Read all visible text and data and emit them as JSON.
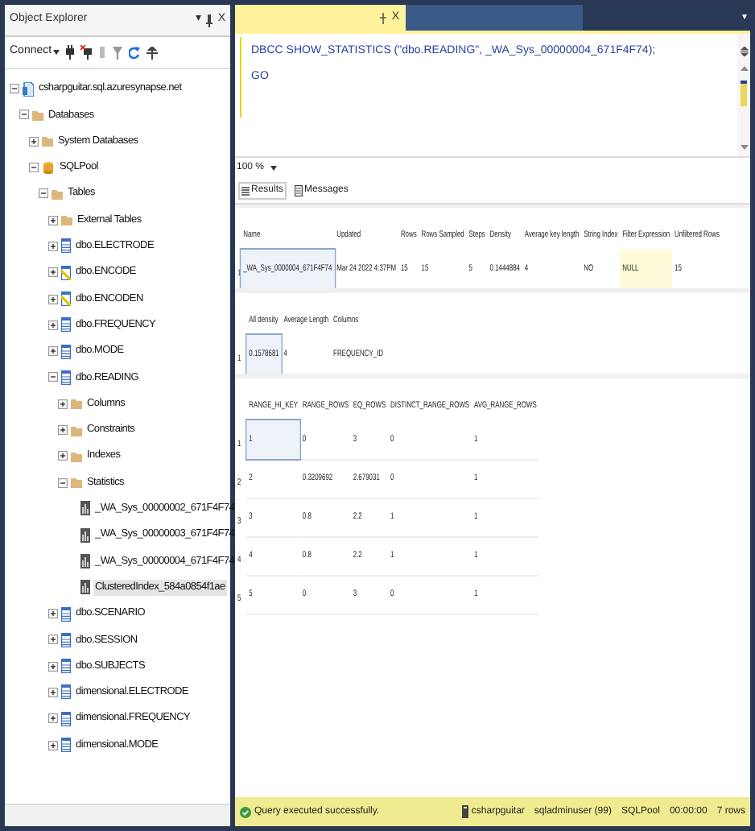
{
  "object_explorer": {
    "title": "Object Explorer",
    "title_buttons": [
      "▾",
      "X"
    ],
    "connect_label": "Connect",
    "tree": [
      {
        "label": "csharpguitar.sql.azuresynapse.net",
        "kind": "server",
        "expanded": true,
        "selected": false,
        "children": [
          {
            "label": "Databases",
            "kind": "folder",
            "expanded": true,
            "selected": false,
            "children": [
              {
                "label": "System Databases",
                "kind": "folder",
                "expanded": false,
                "selected": false
              },
              {
                "label": "SQLPool",
                "kind": "database",
                "expanded": true,
                "selected": false,
                "children": [
                  {
                    "label": "Tables",
                    "kind": "folder",
                    "expanded": true,
                    "selected": false,
                    "children": [
                      {
                        "label": "External Tables",
                        "kind": "folder",
                        "expanded": false,
                        "selected": false
                      },
                      {
                        "label": "dbo.ELECTRODE",
                        "kind": "table",
                        "expanded": false,
                        "selected": false
                      },
                      {
                        "label": "dbo.ENCODE",
                        "kind": "table-alt",
                        "expanded": false,
                        "selected": false
                      },
                      {
                        "label": "dbo.ENCODEN",
                        "kind": "table-alt",
                        "expanded": false,
                        "selected": false
                      },
                      {
                        "label": "dbo.FREQUENCY",
                        "kind": "table",
                        "expanded": false,
                        "selected": false
                      },
                      {
                        "label": "dbo.MODE",
                        "kind": "table",
                        "expanded": false,
                        "selected": false
                      },
                      {
                        "label": "dbo.READING",
                        "kind": "table",
                        "expanded": true,
                        "selected": false,
                        "children": [
                          {
                            "label": "Columns",
                            "kind": "folder",
                            "expanded": false,
                            "selected": false
                          },
                          {
                            "label": "Constraints",
                            "kind": "folder",
                            "expanded": false,
                            "selected": false
                          },
                          {
                            "label": "Indexes",
                            "kind": "folder",
                            "expanded": false,
                            "selected": false
                          },
                          {
                            "label": "Statistics",
                            "kind": "folder",
                            "expanded": true,
                            "selected": false,
                            "children": [
                              {
                                "label": "_WA_Sys_00000002_671F4F74",
                                "kind": "statistic",
                                "selected": false
                              },
                              {
                                "label": "_WA_Sys_00000003_671F4F74",
                                "kind": "statistic",
                                "selected": false
                              },
                              {
                                "label": "_WA_Sys_00000004_671F4F74",
                                "kind": "statistic",
                                "selected": false
                              },
                              {
                                "label": "ClusteredIndex_584a0854f1ae",
                                "kind": "statistic",
                                "selected": true
                              }
                            ]
                          }
                        ]
                      },
                      {
                        "label": "dbo.SCENARIO",
                        "kind": "table",
                        "expanded": false,
                        "selected": false
                      },
                      {
                        "label": "dbo.SESSION",
                        "kind": "table",
                        "expanded": false,
                        "selected": false
                      },
                      {
                        "label": "dbo.SUBJECTS",
                        "kind": "table",
                        "expanded": false,
                        "selected": false
                      },
                      {
                        "label": "dimensional.ELECTRODE",
                        "kind": "table",
                        "expanded": false,
                        "selected": false
                      },
                      {
                        "label": "dimensional.FREQUENCY",
                        "kind": "table",
                        "expanded": false,
                        "selected": false
                      },
                      {
                        "label": "dimensional.MODE",
                        "kind": "table",
                        "expanded": false,
                        "selected": false
                      }
                    ]
                  }
                ]
              }
            ]
          }
        ]
      }
    ]
  },
  "editor": {
    "tab_close": "X",
    "dropdown": "▾",
    "lines": [
      "DBCC SHOW_STATISTICS (\"dbo.READING\", _WA_Sys_00000004_671F4F74);",
      "GO"
    ]
  },
  "zoom": "100 %",
  "result_tabs": [
    {
      "label": "Results",
      "selected": true
    },
    {
      "label": "Messages",
      "selected": false
    }
  ],
  "grids": [
    {
      "columns": [
        "Name",
        "Updated",
        "Rows",
        "Rows Sampled",
        "Steps",
        "Density",
        "Average key length",
        "String Index",
        "Filter Expression",
        "Unfiltered Rows"
      ],
      "rows": [
        {
          "number": "1",
          "cells": [
            {
              "text": "_WA_Sys_0000004_671F4F74",
              "focused": true
            },
            {
              "text": "Mar 24 2022 4:37PM"
            },
            {
              "text": "15"
            },
            {
              "text": "15"
            },
            {
              "text": "5"
            },
            {
              "text": "0.1444884"
            },
            {
              "text": "4"
            },
            {
              "text": "NO"
            },
            {
              "text": "NULL",
              "kind": "null"
            },
            {
              "text": "15"
            }
          ]
        }
      ]
    },
    {
      "columns": [
        "All density",
        "Average Length",
        "Columns"
      ],
      "rows": [
        {
          "number": "1",
          "cells": [
            {
              "text": "0.1578681",
              "focused": true
            },
            {
              "text": "4"
            },
            {
              "text": "FREQUENCY_ID"
            }
          ]
        }
      ]
    },
    {
      "columns": [
        "RANGE_HI_KEY",
        "RANGE_ROWS",
        "EQ_ROWS",
        "DISTINCT_RANGE_ROWS",
        "AVG_RANGE_ROWS"
      ],
      "rows": [
        {
          "number": "1",
          "cells": [
            {
              "text": "1",
              "focused": true
            },
            {
              "text": "0"
            },
            {
              "text": "3"
            },
            {
              "text": "0"
            },
            {
              "text": "1"
            }
          ]
        },
        {
          "number": "2",
          "cells": [
            {
              "text": "2"
            },
            {
              "text": "0.3209692"
            },
            {
              "text": "2.679031"
            },
            {
              "text": "0"
            },
            {
              "text": "1"
            }
          ]
        },
        {
          "number": "3",
          "cells": [
            {
              "text": "3"
            },
            {
              "text": "0.8"
            },
            {
              "text": "2.2"
            },
            {
              "text": "1"
            },
            {
              "text": "1"
            }
          ]
        },
        {
          "number": "4",
          "cells": [
            {
              "text": "4"
            },
            {
              "text": "0.8"
            },
            {
              "text": "2.2"
            },
            {
              "text": "1"
            },
            {
              "text": "1"
            }
          ]
        },
        {
          "number": "5",
          "cells": [
            {
              "text": "5"
            },
            {
              "text": "0"
            },
            {
              "text": "3"
            },
            {
              "text": "0"
            },
            {
              "text": "1"
            }
          ]
        }
      ]
    }
  ],
  "status_bar": {
    "message": "Query executed successfully.",
    "server": "csharpguitar",
    "user": "sqladminuser (99)",
    "database": "SQLPool",
    "elapsed": "00:00:00",
    "rows": "7 rows"
  }
}
